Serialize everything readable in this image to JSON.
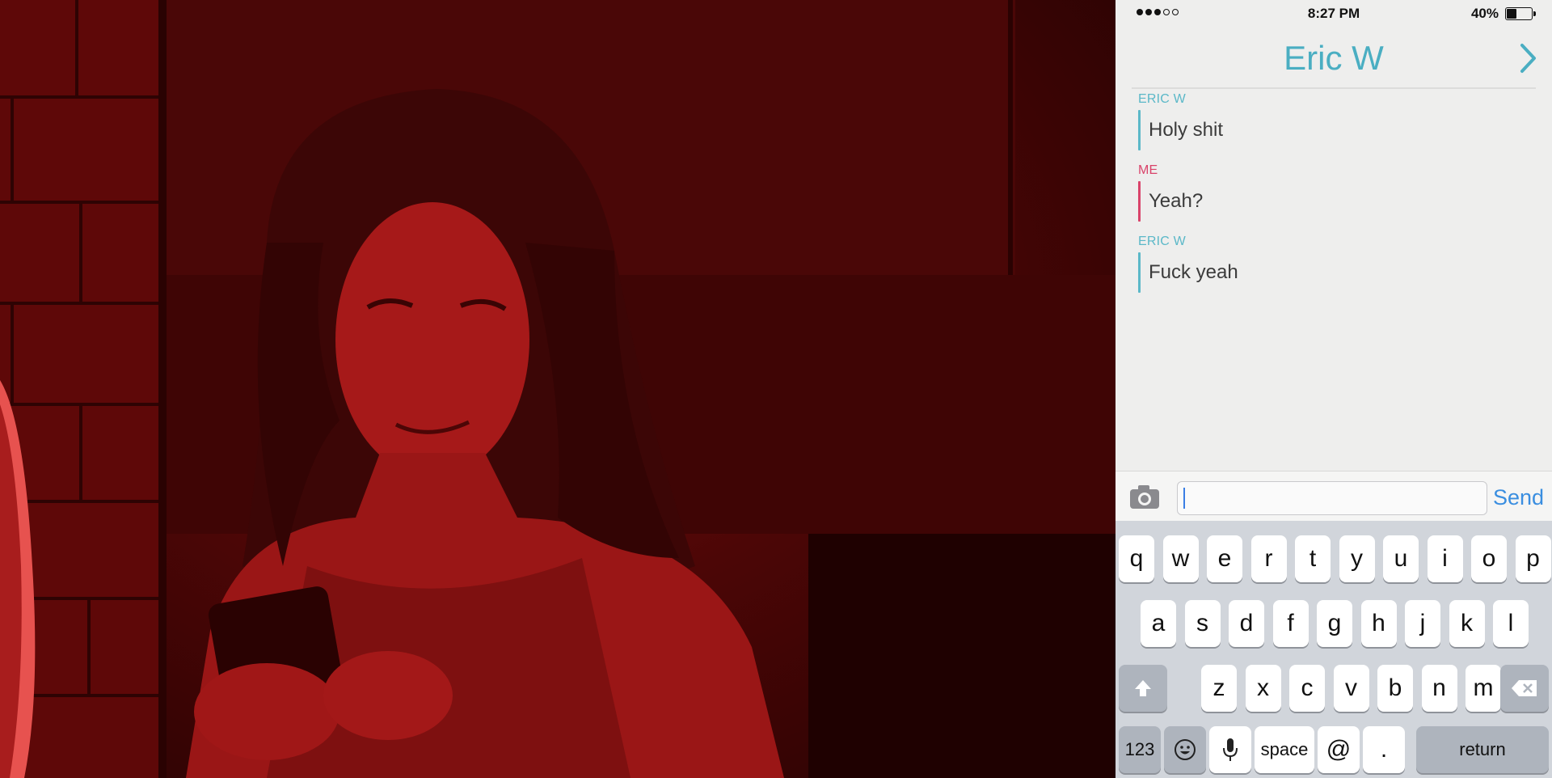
{
  "status_bar": {
    "signal_dots_filled": 3,
    "signal_dots_total": 5,
    "time": "8:27 PM",
    "battery_percent": "40%",
    "battery_level": 0.4
  },
  "conversation": {
    "title": "Eric W",
    "forward_icon": "chevron-right-icon",
    "accent_color": "#4aaec2"
  },
  "messages": [
    {
      "sender": "ERIC W",
      "text": "Holy shit",
      "color": "#5bb8c8"
    },
    {
      "sender": "ME",
      "text": "Yeah?",
      "color": "#d9436a"
    },
    {
      "sender": "ERIC W",
      "text": "Fuck yeah",
      "color": "#5bb8c8"
    }
  ],
  "composer": {
    "camera_icon": "camera-icon",
    "input_value": "",
    "send_label": "Send"
  },
  "keyboard": {
    "row1": [
      "q",
      "w",
      "e",
      "r",
      "t",
      "y",
      "u",
      "i",
      "o",
      "p"
    ],
    "row2": [
      "a",
      "s",
      "d",
      "f",
      "g",
      "h",
      "j",
      "k",
      "l"
    ],
    "row3": [
      "z",
      "x",
      "c",
      "v",
      "b",
      "n",
      "m"
    ],
    "shift_icon": "shift-arrow-icon",
    "delete_icon": "backspace-icon",
    "numbers_label": "123",
    "emoji_icon": "emoji-icon",
    "mic_icon": "microphone-icon",
    "space_label": "space",
    "at_label": "@",
    "period_label": ".",
    "return_label": "return"
  }
}
